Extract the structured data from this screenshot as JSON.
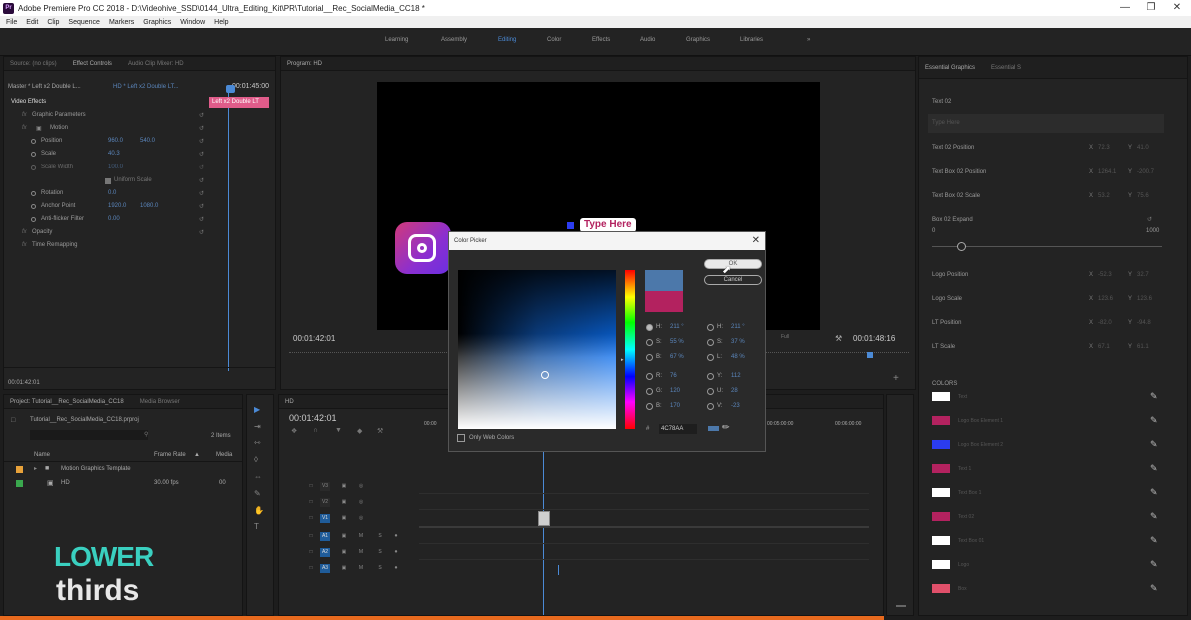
{
  "window": {
    "title": "Adobe Premiere Pro CC 2018 - D:\\Videohive_SSD\\0144_Ultra_Editing_Kit\\PR\\Tutorial__Rec_SocialMedia_CC18 *",
    "app_icon": "Pr"
  },
  "menu": [
    "File",
    "Edit",
    "Clip",
    "Sequence",
    "Markers",
    "Graphics",
    "Window",
    "Help"
  ],
  "workspaces": [
    "Learning",
    "Assembly",
    "Editing",
    "Color",
    "Effects",
    "Audio",
    "Graphics",
    "Libraries"
  ],
  "workspaces_more": "»",
  "source_panel": {
    "tabs": [
      "Source: (no clips)",
      "Effect Controls",
      "Audio Clip Mixer: HD"
    ],
    "master_clip": "Master * Left x2 Double L...",
    "sequence_clip": "HD * Left x2 Double LT...",
    "timecode_head": "00:01:45:00",
    "clip_bar_label": "Left x2 Double LT",
    "section": "Video Effects",
    "rows": [
      {
        "label": "Graphic Parameters"
      },
      {
        "label": "Motion"
      },
      {
        "label": "Position",
        "v1": "960.0",
        "v2": "540.0"
      },
      {
        "label": "Scale",
        "v1": "40.3"
      },
      {
        "label": "Scale Width",
        "v1": "100.0"
      },
      {
        "label": "Uniform Scale"
      },
      {
        "label": "Rotation",
        "v1": "0.0"
      },
      {
        "label": "Anchor Point",
        "v1": "1920.0",
        "v2": "1080.0"
      },
      {
        "label": "Anti-flicker Filter",
        "v1": "0.00"
      },
      {
        "label": "Opacity"
      },
      {
        "label": "Time Remapping"
      }
    ],
    "footer_timecode": "00:01:42:01"
  },
  "program": {
    "tab": "Program: HD",
    "overlay_text": "Type Here",
    "timecode_left": "00:01:42:01",
    "timecode_right": "00:01:48:16",
    "fit": "Full"
  },
  "project": {
    "tabs": [
      "Project: Tutorial__Rec_SocialMedia_CC18",
      "Media Browser"
    ],
    "file": "Tutorial__Rec_SocialMedia_CC18.prproj",
    "items_count": "2 Items",
    "columns": [
      "Name",
      "Frame Rate",
      "Media"
    ],
    "rows": [
      {
        "name": "Motion Graphics Template",
        "rate": "",
        "color": "#e8a23a"
      },
      {
        "name": "HD",
        "rate": "30.00 fps",
        "media": "00",
        "color": "#3aa84e"
      }
    ]
  },
  "timeline": {
    "tab": "HD",
    "timecode": "00:01:42:01",
    "ruler": [
      "00:00",
      "00:05:00:00",
      "00:06:00:00"
    ],
    "tracks": [
      "V3",
      "V2",
      "V1",
      "A1",
      "A2",
      "A3"
    ]
  },
  "essential_graphics": {
    "tabs": [
      "Essential Graphics",
      "Essential S"
    ],
    "text_label": "Text 02",
    "text_value": "Type Here",
    "props": [
      {
        "label": "Text 02 Position",
        "x": "72.3",
        "y": "41.0"
      },
      {
        "label": "Text Box 02 Position",
        "x": "1264.1",
        "y": "-200.7"
      },
      {
        "label": "Text Box 02 Scale",
        "x": "53.2",
        "y": "75.6"
      }
    ],
    "expand_label": "Box 02 Expand",
    "expand_min": "0",
    "expand_max": "1000",
    "props2": [
      {
        "label": "Logo Position",
        "x": "-52.3",
        "y": "32.7"
      },
      {
        "label": "Logo Scale",
        "x": "123.6",
        "y": "123.6"
      },
      {
        "label": "LT Position",
        "x": "-82.0",
        "y": "-94.8"
      },
      {
        "label": "LT Scale",
        "x": "67.1",
        "y": "61.1"
      }
    ],
    "colors_title": "COLORS",
    "swatches": [
      {
        "color": "#ffffff",
        "label": "Text"
      },
      {
        "color": "#b3225f",
        "label": "Logo Box Element 1"
      },
      {
        "color": "#2b3cf0",
        "label": "Logo Box Element 2"
      },
      {
        "color": "#b3225f",
        "label": "Text 1"
      },
      {
        "color": "#ffffff",
        "label": "Text Box 1"
      },
      {
        "color": "#b3225f",
        "label": "Text 02"
      },
      {
        "color": "#ffffff",
        "label": "Text Box 01"
      },
      {
        "color": "#ffffff",
        "label": "Logo"
      },
      {
        "color": "#e0506a",
        "label": "Box"
      }
    ]
  },
  "color_picker": {
    "title": "Color Picker",
    "ok": "OK",
    "cancel": "Cancel",
    "only_web": "Only Web Colors",
    "hex_label": "#",
    "hex": "4C78AA",
    "new_color": "#4c78aa",
    "old_color": "#b3225f",
    "left": [
      {
        "k": "H:",
        "v": "211 °"
      },
      {
        "k": "S:",
        "v": "55 %"
      },
      {
        "k": "B:",
        "v": "67 %"
      },
      {
        "k": "R:",
        "v": "76"
      },
      {
        "k": "G:",
        "v": "120"
      },
      {
        "k": "B:",
        "v": "170"
      }
    ],
    "right": [
      {
        "k": "H:",
        "v": "211 °"
      },
      {
        "k": "S:",
        "v": "37 %"
      },
      {
        "k": "L:",
        "v": "48 %"
      },
      {
        "k": "Y:",
        "v": "112"
      },
      {
        "k": "U:",
        "v": "28"
      },
      {
        "k": "V:",
        "v": "-23"
      }
    ]
  },
  "watermark": {
    "line1": "LOWER",
    "line2": "thirds"
  }
}
